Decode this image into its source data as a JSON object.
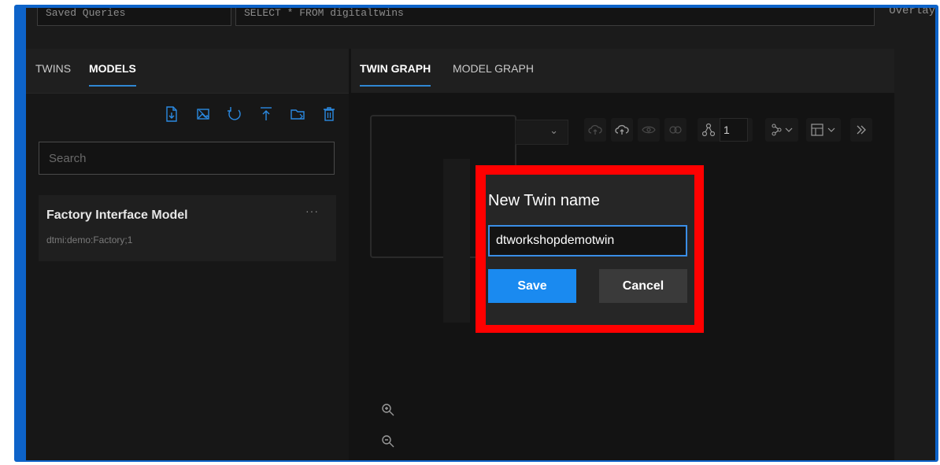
{
  "query": {
    "saved_queries_placeholder": "Saved Queries",
    "query_text": "SELECT * FROM digitaltwins",
    "overlay_label": "Overlay"
  },
  "left_panel": {
    "tabs": [
      {
        "label": "TWINS",
        "active": false
      },
      {
        "label": "MODELS",
        "active": true
      }
    ],
    "toolbar_icons": [
      "upload-model-icon",
      "upload-images-icon",
      "refresh-icon",
      "download-icon",
      "open-folder-icon",
      "delete-icon"
    ],
    "search_placeholder": "Search",
    "models": [
      {
        "name": "Factory Interface Model",
        "id": "dtmi:demo:Factory;1",
        "menu": "···"
      }
    ]
  },
  "right_panel": {
    "tabs": [
      {
        "label": "TWIN GRAPH",
        "active": true
      },
      {
        "label": "MODEL GRAPH",
        "active": false
      }
    ],
    "graph_toolbar": {
      "depth_value": "1",
      "icons": [
        "cloud-upload-disabled-icon",
        "cloud-upload-icon",
        "eye-icon",
        "link-icon",
        "depth-icon",
        "layout-icon",
        "table-icon",
        "expand-icon"
      ]
    },
    "zoom_icons": [
      "zoom-in-icon",
      "zoom-out-icon"
    ]
  },
  "dialog": {
    "title": "New Twin name",
    "input_value": "dtworkshopdemotwin",
    "save_label": "Save",
    "cancel_label": "Cancel",
    "highlight_color": "#ff0000",
    "save_color": "#1a8af0"
  },
  "colors": {
    "accent": "#2f87d3",
    "icon_blue": "#2b8ae2",
    "frame": "#0d63c9"
  }
}
